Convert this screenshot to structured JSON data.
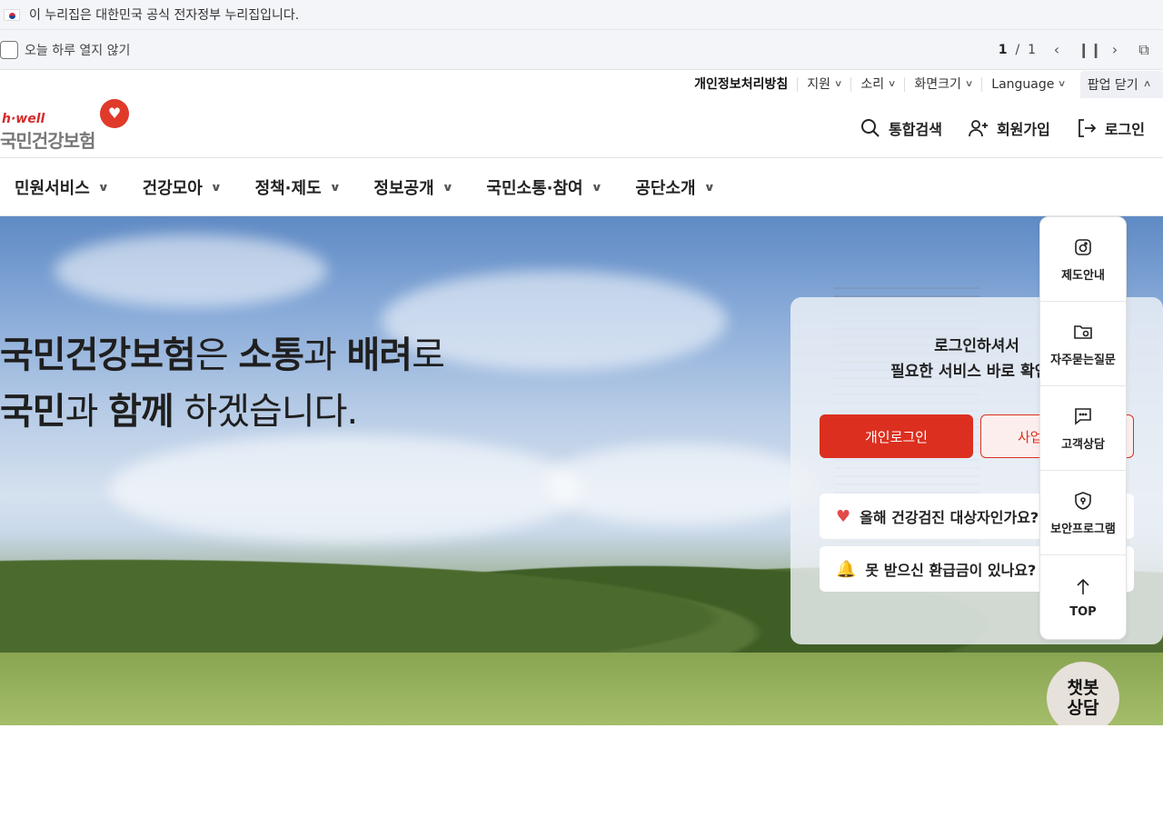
{
  "gov_banner": {
    "text": "이 누리집은 대한민국 공식 전자정부 누리집입니다."
  },
  "popup_bar": {
    "checkbox_label": "오늘 하루 열지 않기",
    "page_current": "1",
    "page_sep": "/",
    "page_total": "1"
  },
  "utility": {
    "privacy": "개인정보처리방침",
    "support": "지원",
    "sound": "소리",
    "screen_size": "화면크기",
    "language": "Language",
    "popup_close": "팝업 닫기"
  },
  "logo": {
    "tagline": "h·well",
    "name": "국민건강보험"
  },
  "header_actions": {
    "search": "통합검색",
    "signup": "회원가입",
    "login": "로그인"
  },
  "gnb": [
    "민원서비스",
    "건강모아",
    "정책·제도",
    "정보공개",
    "국민소통·참여",
    "공단소개"
  ],
  "hero": {
    "line1": [
      {
        "text": "국민건강보험",
        "bold": true
      },
      {
        "text": "은 ",
        "bold": false
      },
      {
        "text": "소통",
        "bold": true
      },
      {
        "text": "과 ",
        "bold": false
      },
      {
        "text": "배려",
        "bold": true
      },
      {
        "text": "로",
        "bold": false
      }
    ],
    "line2": [
      {
        "text": "국민",
        "bold": true
      },
      {
        "text": "과 ",
        "bold": false
      },
      {
        "text": "함께",
        "bold": true
      },
      {
        "text": " 하겠습니다.",
        "bold": false
      }
    ]
  },
  "login_panel": {
    "title_line1": "로그인하셔서",
    "title_line2": "필요한 서비스 바로 확인하",
    "personal_login": "개인로그인",
    "business_login": "사업",
    "question1": "올해 건강검진 대상자인가요?",
    "question2": "못 받으신 환급금이 있나요?"
  },
  "quick_menu": {
    "system_guide": "제도안내",
    "faq": "자주묻는질문",
    "consult": "고객상담",
    "security": "보안프로그램",
    "top": "TOP"
  },
  "chatbot": {
    "line1": "챗봇",
    "line2": "상담"
  }
}
